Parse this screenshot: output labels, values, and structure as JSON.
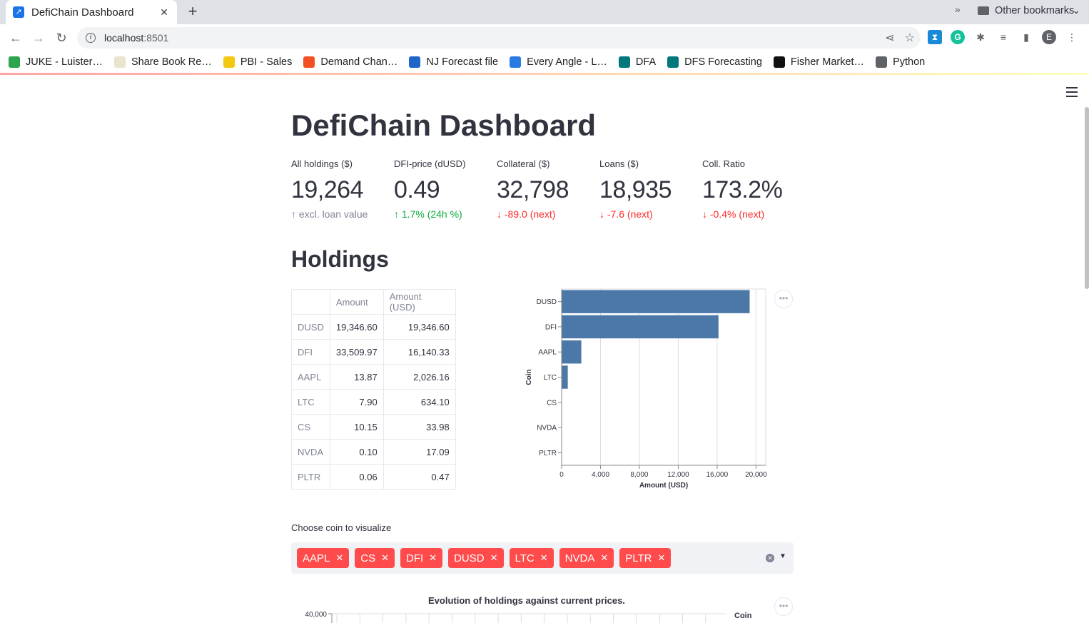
{
  "browser": {
    "tab_title": "DefiChain Dashboard",
    "tab_close": "✕",
    "new_tab": "+",
    "tab_menu": "⌄",
    "url_host": "localhost",
    "url_port": ":8501",
    "avatar_letter": "E",
    "bookmarks": [
      {
        "label": "JUKE - Luister…",
        "icon": "juke-icon",
        "color": "#2da44e"
      },
      {
        "label": "Share Book Re…",
        "icon": "goodreads-icon",
        "color": "#e9e5cd"
      },
      {
        "label": "PBI - Sales",
        "icon": "powerbi-icon",
        "color": "#f2c811"
      },
      {
        "label": "Demand Chan…",
        "icon": "microsoft-icon",
        "color": "#f25022"
      },
      {
        "label": "NJ Forecast file",
        "icon": "s-icon",
        "color": "#1f64c7"
      },
      {
        "label": "Every Angle - L…",
        "icon": "everyangle-icon",
        "color": "#2a7ae2"
      },
      {
        "label": "DFA",
        "icon": "sharepoint-icon",
        "color": "#03787c"
      },
      {
        "label": "DFS Forecasting",
        "icon": "sharepoint-icon",
        "color": "#03787c"
      },
      {
        "label": "Fisher Market…",
        "icon": "fisher-icon",
        "color": "#111111"
      },
      {
        "label": "Python",
        "icon": "folder-icon",
        "color": "#5f6368"
      }
    ],
    "bookmarks_more": "»",
    "other_bookmarks": "Other bookmarks"
  },
  "page": {
    "title": "DefiChain Dashboard",
    "metrics": [
      {
        "label": "All holdings ($)",
        "value": "19,264",
        "delta": "excl. loan value",
        "direction": "off"
      },
      {
        "label": "DFI-price (dUSD)",
        "value": "0.49",
        "delta": "1.7% (24h %)",
        "direction": "up"
      },
      {
        "label": "Collateral ($)",
        "value": "32,798",
        "delta": "-89.0 (next)",
        "direction": "down"
      },
      {
        "label": "Loans ($)",
        "value": "18,935",
        "delta": "-7.6 (next)",
        "direction": "down"
      },
      {
        "label": "Coll. Ratio",
        "value": "173.2%",
        "delta": "-0.4% (next)",
        "direction": "down"
      }
    ],
    "holdings_title": "Holdings",
    "table": {
      "columns": [
        "",
        "Amount",
        "Amount (USD)"
      ],
      "rows": [
        {
          "coin": "DUSD",
          "amount": "19,346.60",
          "usd": "19,346.60"
        },
        {
          "coin": "DFI",
          "amount": "33,509.97",
          "usd": "16,140.33"
        },
        {
          "coin": "AAPL",
          "amount": "13.87",
          "usd": "2,026.16"
        },
        {
          "coin": "LTC",
          "amount": "7.90",
          "usd": "634.10"
        },
        {
          "coin": "CS",
          "amount": "10.15",
          "usd": "33.98"
        },
        {
          "coin": "NVDA",
          "amount": "0.10",
          "usd": "17.09"
        },
        {
          "coin": "PLTR",
          "amount": "0.06",
          "usd": "0.47"
        }
      ]
    },
    "select": {
      "label": "Choose coin to visualize",
      "chips": [
        "AAPL",
        "CS",
        "DFI",
        "DUSD",
        "LTC",
        "NVDA",
        "PLTR"
      ],
      "chip_remove": "✕",
      "clear": "✕",
      "caret": "▼"
    },
    "evolution": {
      "title": "Evolution of holdings against current prices.",
      "y_top_tick": "40,000",
      "legend_title": "Coin"
    },
    "menu_kebab": "•••"
  },
  "chart_data": [
    {
      "type": "bar",
      "orientation": "horizontal",
      "categories": [
        "DUSD",
        "DFI",
        "AAPL",
        "LTC",
        "CS",
        "NVDA",
        "PLTR"
      ],
      "values": [
        19346.6,
        16140.33,
        2026.16,
        634.1,
        33.98,
        17.09,
        0.47
      ],
      "xlabel": "Amount (USD)",
      "ylabel": "Coin",
      "xlim": [
        0,
        21000
      ],
      "xticks": [
        "0",
        "4,000",
        "8,000",
        "12,000",
        "16,000",
        "20,000"
      ],
      "xtick_values": [
        0,
        4000,
        8000,
        12000,
        16000,
        20000
      ],
      "grid": true,
      "color": "#4c78a8"
    }
  ]
}
